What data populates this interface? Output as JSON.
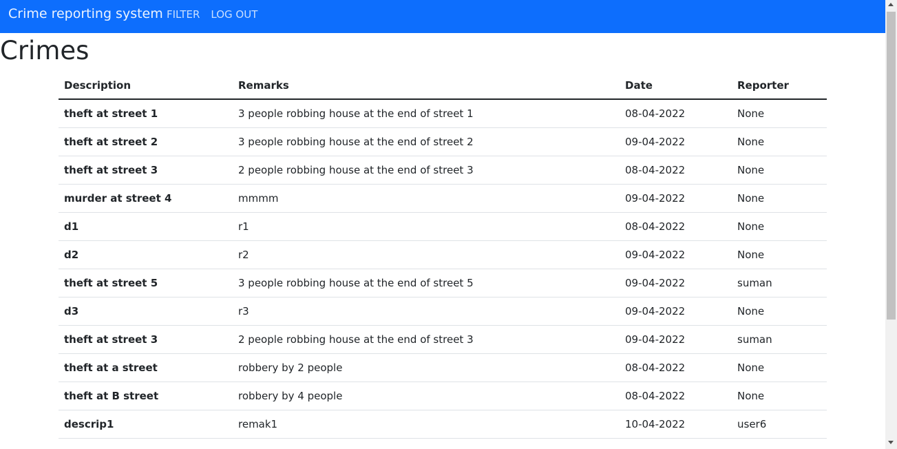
{
  "navbar": {
    "brand": "Crime reporting system",
    "links": [
      "FILTER",
      "LOG OUT"
    ],
    "color": "#0d6efd"
  },
  "page": {
    "title": "Crimes"
  },
  "table": {
    "headers": [
      "Description",
      "Remarks",
      "Date",
      "Reporter"
    ],
    "rows": [
      [
        "theft at street 1",
        "3 people robbing house at the end of street 1",
        "08-04-2022",
        "None"
      ],
      [
        "theft at street 2",
        "3 people robbing house at the end of street 2",
        "09-04-2022",
        "None"
      ],
      [
        "theft at street 3",
        "2 people robbing house at the end of street 3",
        "08-04-2022",
        "None"
      ],
      [
        "murder at street 4",
        "mmmm",
        "09-04-2022",
        "None"
      ],
      [
        "d1",
        "r1",
        "08-04-2022",
        "None"
      ],
      [
        "d2",
        "r2",
        "09-04-2022",
        "None"
      ],
      [
        "theft at street 5",
        "3 people robbing house at the end of street 5",
        "09-04-2022",
        "suman"
      ],
      [
        "d3",
        "r3",
        "09-04-2022",
        "None"
      ],
      [
        "theft at street 3",
        "2 people robbing house at the end of street 3",
        "09-04-2022",
        "suman"
      ],
      [
        "theft at a street",
        "robbery by 2 people",
        "08-04-2022",
        "None"
      ],
      [
        "theft at B street",
        "robbery by 4 people",
        "08-04-2022",
        "None"
      ],
      [
        "descrip1",
        "remak1",
        "10-04-2022",
        "user6"
      ]
    ]
  },
  "icons": {
    "scroll_up": "chevron-up-icon",
    "scroll_down": "chevron-down-icon"
  }
}
